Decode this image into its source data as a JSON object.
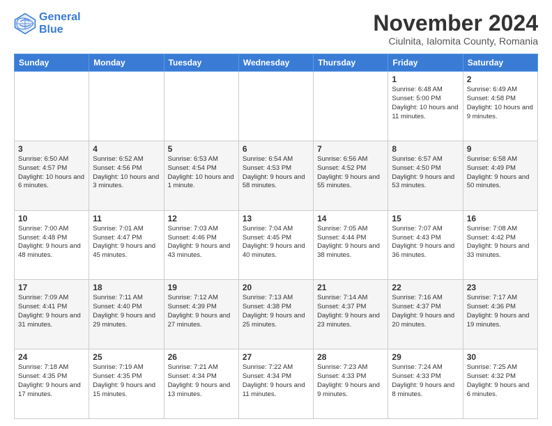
{
  "logo": {
    "line1": "General",
    "line2": "Blue"
  },
  "title": "November 2024",
  "subtitle": "Ciulnita, Ialomita County, Romania",
  "headers": [
    "Sunday",
    "Monday",
    "Tuesday",
    "Wednesday",
    "Thursday",
    "Friday",
    "Saturday"
  ],
  "weeks": [
    [
      {
        "day": "",
        "info": ""
      },
      {
        "day": "",
        "info": ""
      },
      {
        "day": "",
        "info": ""
      },
      {
        "day": "",
        "info": ""
      },
      {
        "day": "",
        "info": ""
      },
      {
        "day": "1",
        "info": "Sunrise: 6:48 AM\nSunset: 5:00 PM\nDaylight: 10 hours and 11 minutes."
      },
      {
        "day": "2",
        "info": "Sunrise: 6:49 AM\nSunset: 4:58 PM\nDaylight: 10 hours and 9 minutes."
      }
    ],
    [
      {
        "day": "3",
        "info": "Sunrise: 6:50 AM\nSunset: 4:57 PM\nDaylight: 10 hours and 6 minutes."
      },
      {
        "day": "4",
        "info": "Sunrise: 6:52 AM\nSunset: 4:56 PM\nDaylight: 10 hours and 3 minutes."
      },
      {
        "day": "5",
        "info": "Sunrise: 6:53 AM\nSunset: 4:54 PM\nDaylight: 10 hours and 1 minute."
      },
      {
        "day": "6",
        "info": "Sunrise: 6:54 AM\nSunset: 4:53 PM\nDaylight: 9 hours and 58 minutes."
      },
      {
        "day": "7",
        "info": "Sunrise: 6:56 AM\nSunset: 4:52 PM\nDaylight: 9 hours and 55 minutes."
      },
      {
        "day": "8",
        "info": "Sunrise: 6:57 AM\nSunset: 4:50 PM\nDaylight: 9 hours and 53 minutes."
      },
      {
        "day": "9",
        "info": "Sunrise: 6:58 AM\nSunset: 4:49 PM\nDaylight: 9 hours and 50 minutes."
      }
    ],
    [
      {
        "day": "10",
        "info": "Sunrise: 7:00 AM\nSunset: 4:48 PM\nDaylight: 9 hours and 48 minutes."
      },
      {
        "day": "11",
        "info": "Sunrise: 7:01 AM\nSunset: 4:47 PM\nDaylight: 9 hours and 45 minutes."
      },
      {
        "day": "12",
        "info": "Sunrise: 7:03 AM\nSunset: 4:46 PM\nDaylight: 9 hours and 43 minutes."
      },
      {
        "day": "13",
        "info": "Sunrise: 7:04 AM\nSunset: 4:45 PM\nDaylight: 9 hours and 40 minutes."
      },
      {
        "day": "14",
        "info": "Sunrise: 7:05 AM\nSunset: 4:44 PM\nDaylight: 9 hours and 38 minutes."
      },
      {
        "day": "15",
        "info": "Sunrise: 7:07 AM\nSunset: 4:43 PM\nDaylight: 9 hours and 36 minutes."
      },
      {
        "day": "16",
        "info": "Sunrise: 7:08 AM\nSunset: 4:42 PM\nDaylight: 9 hours and 33 minutes."
      }
    ],
    [
      {
        "day": "17",
        "info": "Sunrise: 7:09 AM\nSunset: 4:41 PM\nDaylight: 9 hours and 31 minutes."
      },
      {
        "day": "18",
        "info": "Sunrise: 7:11 AM\nSunset: 4:40 PM\nDaylight: 9 hours and 29 minutes."
      },
      {
        "day": "19",
        "info": "Sunrise: 7:12 AM\nSunset: 4:39 PM\nDaylight: 9 hours and 27 minutes."
      },
      {
        "day": "20",
        "info": "Sunrise: 7:13 AM\nSunset: 4:38 PM\nDaylight: 9 hours and 25 minutes."
      },
      {
        "day": "21",
        "info": "Sunrise: 7:14 AM\nSunset: 4:37 PM\nDaylight: 9 hours and 23 minutes."
      },
      {
        "day": "22",
        "info": "Sunrise: 7:16 AM\nSunset: 4:37 PM\nDaylight: 9 hours and 20 minutes."
      },
      {
        "day": "23",
        "info": "Sunrise: 7:17 AM\nSunset: 4:36 PM\nDaylight: 9 hours and 19 minutes."
      }
    ],
    [
      {
        "day": "24",
        "info": "Sunrise: 7:18 AM\nSunset: 4:35 PM\nDaylight: 9 hours and 17 minutes."
      },
      {
        "day": "25",
        "info": "Sunrise: 7:19 AM\nSunset: 4:35 PM\nDaylight: 9 hours and 15 minutes."
      },
      {
        "day": "26",
        "info": "Sunrise: 7:21 AM\nSunset: 4:34 PM\nDaylight: 9 hours and 13 minutes."
      },
      {
        "day": "27",
        "info": "Sunrise: 7:22 AM\nSunset: 4:34 PM\nDaylight: 9 hours and 11 minutes."
      },
      {
        "day": "28",
        "info": "Sunrise: 7:23 AM\nSunset: 4:33 PM\nDaylight: 9 hours and 9 minutes."
      },
      {
        "day": "29",
        "info": "Sunrise: 7:24 AM\nSunset: 4:33 PM\nDaylight: 9 hours and 8 minutes."
      },
      {
        "day": "30",
        "info": "Sunrise: 7:25 AM\nSunset: 4:32 PM\nDaylight: 9 hours and 6 minutes."
      }
    ]
  ]
}
